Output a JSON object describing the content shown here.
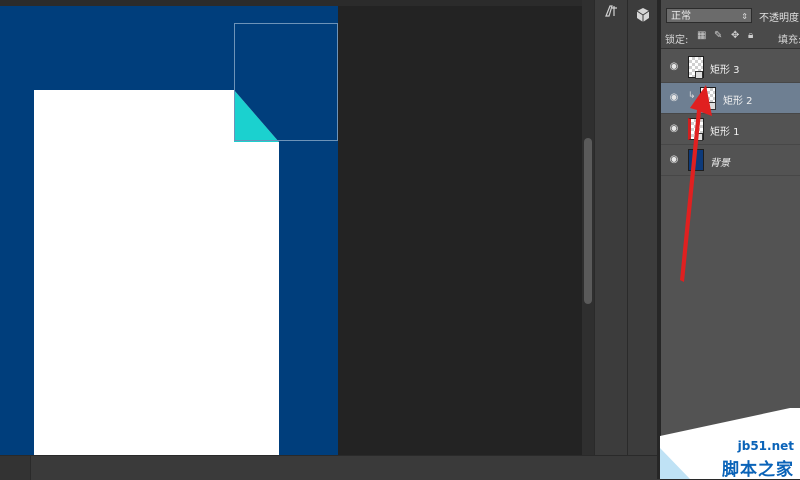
{
  "layers_panel": {
    "blend_mode": "正常",
    "opacity_label": "不透明度",
    "lock_label": "锁定:",
    "fill_label": "填充:",
    "layers": [
      {
        "name": "矩形 3",
        "thumb": "checker",
        "selected": false
      },
      {
        "name": "矩形 2",
        "thumb": "checker",
        "selected": true,
        "clipped": true
      },
      {
        "name": "矩形 1",
        "thumb": "checker-red",
        "selected": false
      },
      {
        "name": "背景",
        "thumb": "blue",
        "selected": false
      }
    ]
  },
  "icons": {
    "dock_top": "paragraph-icon",
    "dock_3d": "3d-cube-icon",
    "eye": "eye-icon"
  },
  "colors": {
    "document_background": "#003e7c",
    "paper": "#ffffff",
    "corner_fold": "#1bd1cf",
    "annotation_arrow": "#e02020",
    "selected_layer": "#6e7f92"
  },
  "watermark": {
    "url": "jb51.net",
    "title": "脚本之家"
  }
}
